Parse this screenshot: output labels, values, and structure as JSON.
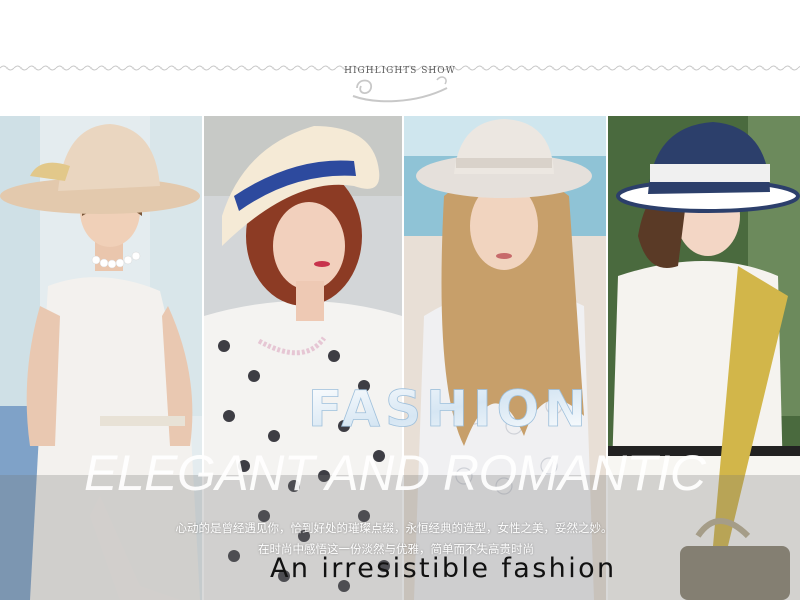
{
  "header": {
    "title": "HIGHLIGHTS SHOW"
  },
  "panels": [
    {
      "model": "woman-wide-brim-hat-pearls",
      "hat_color": "#e6cdb0",
      "bg": "#dfeaf0"
    },
    {
      "model": "woman-boater-hat-blue-band",
      "hat_color": "#f3e7d2",
      "band": "#2d4a9e",
      "bg": "#cfd3d6"
    },
    {
      "model": "woman-fedora-lace-dress",
      "hat_color": "#e7e2dc",
      "bg": "#a8d0dc"
    },
    {
      "model": "woman-striped-navy-hat",
      "hat_color": "#2c3f6b",
      "bg": "#4c6a3f"
    }
  ],
  "overlay": {
    "word": "FASHION",
    "headline": "ELEGANT AND ROMANTIC",
    "line1": "心动的是曾经遇见你，恰到好处的璀璨点缀，永恒经典的造型，女性之美，妥然之妙。",
    "line2": "在时尚中感悟这一份淡然与优雅，简单而不失高贵时尚",
    "tagline": "An irresistible fashion"
  },
  "colors": {
    "band_overlay": "#7f7f7f",
    "headline": "#ffffff",
    "tagline": "#111111"
  }
}
